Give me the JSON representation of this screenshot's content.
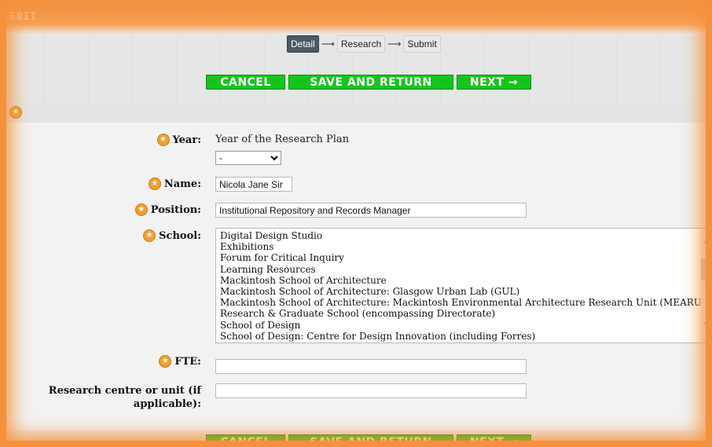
{
  "page": {
    "title": "EDIT"
  },
  "steps": [
    {
      "label": "Detail",
      "active": true
    },
    {
      "label": "Research",
      "active": false
    },
    {
      "label": "Submit",
      "active": false
    }
  ],
  "buttons": {
    "cancel": "CANCEL",
    "save_return": "SAVE AND RETURN",
    "next": "NEXT →"
  },
  "form": {
    "year": {
      "label": "Year:",
      "hint": "Year of the Research Plan",
      "selected": "-"
    },
    "name": {
      "label": "Name:",
      "value": "Nicola Jane Sir"
    },
    "position": {
      "label": "Position:",
      "value": "Institutional Repository and Records Manager"
    },
    "school": {
      "label": "School:",
      "options": [
        "Digital Design Studio",
        "Exhibitions",
        "Forum for Critical Inquiry",
        "Learning Resources",
        "Mackintosh School of Architecture",
        "Mackintosh School of Architecture: Glasgow Urban Lab (GUL)",
        "Mackintosh School of Architecture: Mackintosh Environmental Architecture Research Unit (MEARU)",
        "Research & Graduate School (encompassing Directorate)",
        "School of Design",
        "School of Design: Centre for Design Innovation (including Forres)"
      ]
    },
    "fte": {
      "label": "FTE:",
      "value": ""
    },
    "research_centre": {
      "label": "Research centre or unit (if applicable):",
      "value": ""
    }
  },
  "colors": {
    "accent_orange": "#f5913c",
    "button_green": "#13c51b",
    "active_step": "#4d5a64",
    "star": "#f0a030"
  },
  "icons": {
    "required": "star-icon",
    "arrow": "right-arrow-icon"
  }
}
